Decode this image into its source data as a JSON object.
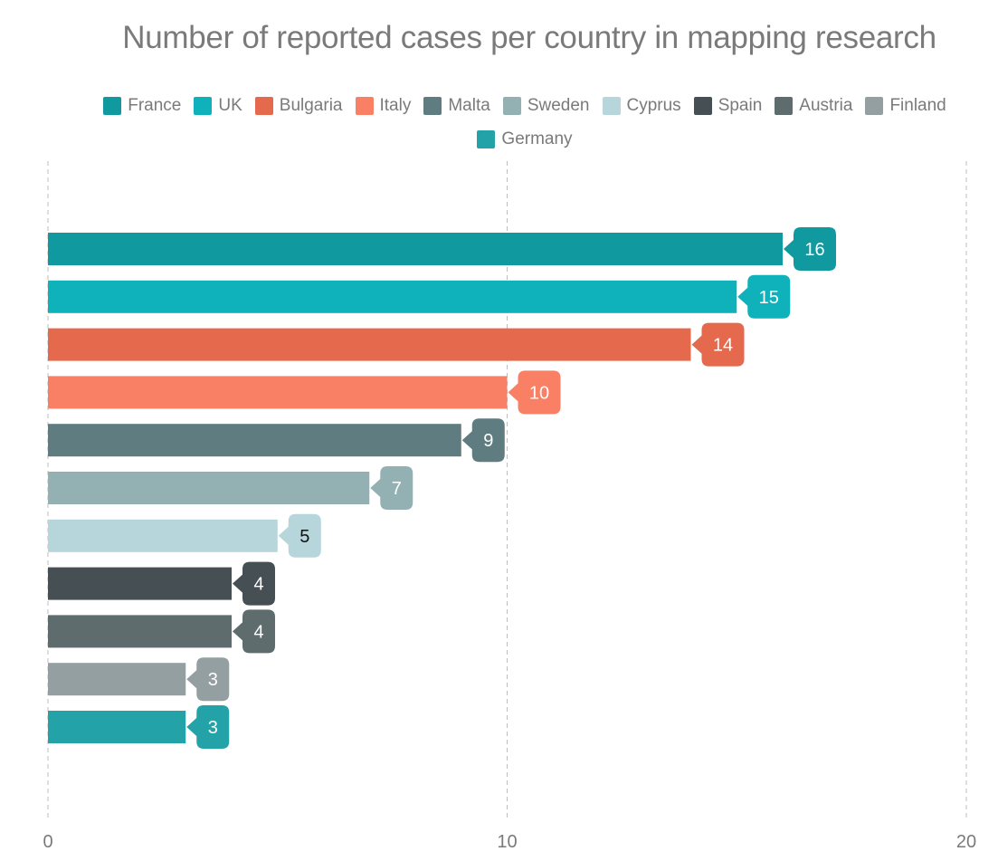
{
  "chart_data": {
    "type": "bar",
    "orientation": "horizontal",
    "title": "Number of reported cases per country in mapping research",
    "xlabel": "",
    "ylabel": "",
    "xlim": [
      0,
      20
    ],
    "x_ticks": [
      "0",
      "10",
      "20"
    ],
    "grid": true,
    "legend_position": "top",
    "categories": [
      "France",
      "UK",
      "Bulgaria",
      "Italy",
      "Malta",
      "Sweden",
      "Cyprus",
      "Spain",
      "Austria",
      "Finland",
      "Germany"
    ],
    "values": [
      16,
      15,
      14,
      10,
      9,
      7,
      5,
      4,
      4,
      3,
      3
    ],
    "colors": [
      "#10999f",
      "#0fb2bb",
      "#e4694d",
      "#fa8065",
      "#5f7c80",
      "#93b0b3",
      "#b6d6dc",
      "#454f54",
      "#5f6c6e",
      "#939fa1",
      "#23a3a8"
    ],
    "label_text_colors": [
      "#ffffff",
      "#ffffff",
      "#ffffff",
      "#ffffff",
      "#ffffff",
      "#ffffff",
      "#111111",
      "#ffffff",
      "#ffffff",
      "#ffffff",
      "#ffffff"
    ],
    "legend": {
      "rows": [
        [
          "France",
          "UK",
          "Bulgaria",
          "Italy",
          "Malta",
          "Sweden",
          "Cyprus",
          "Spain",
          "Austria",
          "Finland"
        ],
        [
          "Germany"
        ]
      ]
    }
  }
}
